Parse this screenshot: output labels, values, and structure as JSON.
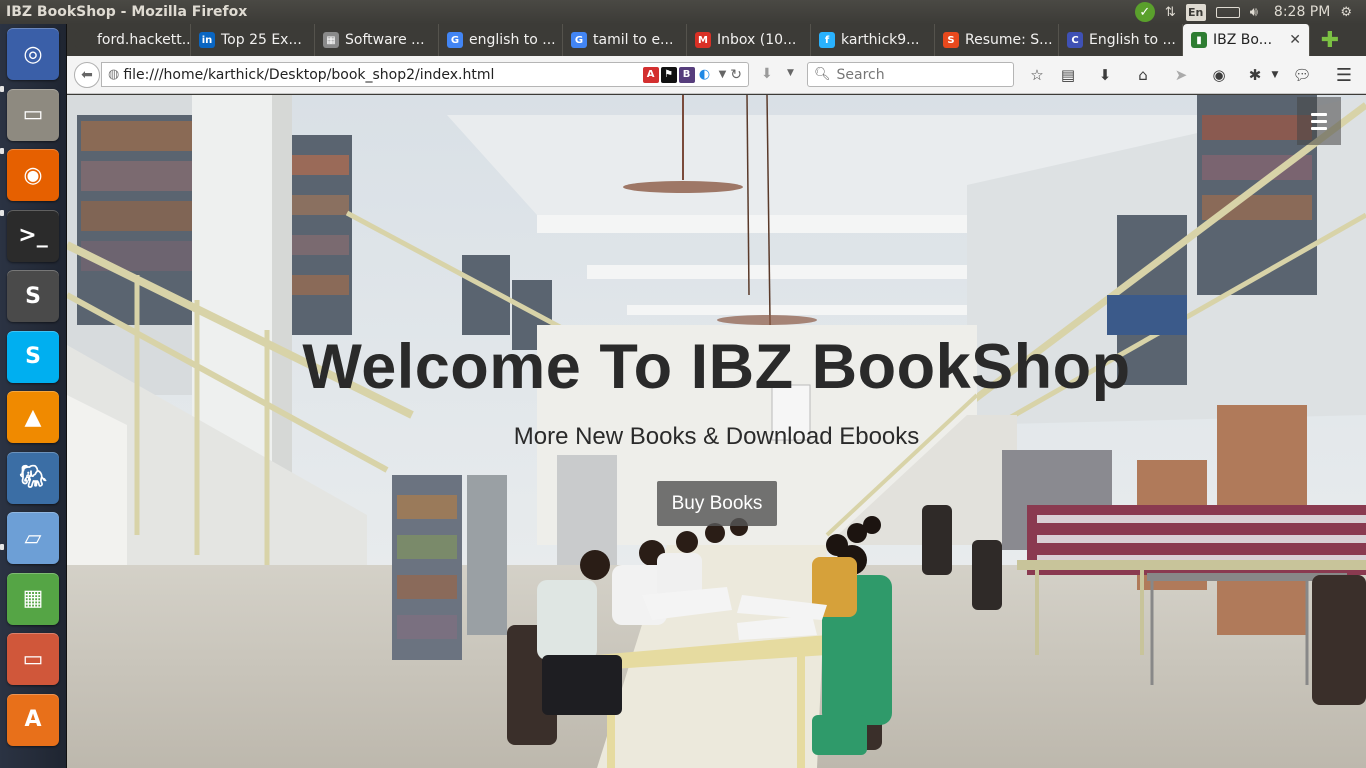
{
  "window": {
    "title": "IBZ BookShop - Mozilla Firefox"
  },
  "panel": {
    "lang": "En",
    "clock": "8:28 PM"
  },
  "launcher": {
    "items": [
      {
        "name": "ubuntu-dash",
        "icon": "ubuntu-logo-icon",
        "color": "#3a5fa8"
      },
      {
        "name": "files",
        "icon": "file-cabinet-icon",
        "color": "#8e8a80"
      },
      {
        "name": "firefox",
        "icon": "firefox-icon",
        "color": "#e66000"
      },
      {
        "name": "terminal",
        "icon": "terminal-icon",
        "color": "#2b2b2b"
      },
      {
        "name": "sublime-text",
        "icon": "sublime-icon",
        "color": "#4a4a4a"
      },
      {
        "name": "skype",
        "icon": "skype-icon",
        "color": "#00aff0"
      },
      {
        "name": "vlc",
        "icon": "vlc-cone-icon",
        "color": "#f08a00"
      },
      {
        "name": "postgresql",
        "icon": "elephant-icon",
        "color": "#3b6ea5"
      },
      {
        "name": "libreoffice-draw",
        "icon": "draw-icon",
        "color": "#6d9fd6"
      },
      {
        "name": "libreoffice-calc",
        "icon": "calc-icon",
        "color": "#55a545"
      },
      {
        "name": "libreoffice-impress",
        "icon": "impress-icon",
        "color": "#d0573a"
      },
      {
        "name": "software-center",
        "icon": "software-bag-icon",
        "color": "#e8701a"
      }
    ]
  },
  "tabs": [
    {
      "label": "ford.hackett...",
      "favicon": "blank",
      "fav_color": "#3c3b37",
      "fav_text": ""
    },
    {
      "label": "Top 25 Ex...",
      "favicon": "linkedin-icon",
      "fav_color": "#0a66c2",
      "fav_text": "in"
    },
    {
      "label": "Software ...",
      "favicon": "grid-icon",
      "fav_color": "#8a8a8a",
      "fav_text": "▦"
    },
    {
      "label": "english to ...",
      "favicon": "google-icon",
      "fav_color": "#4285f4",
      "fav_text": "G"
    },
    {
      "label": "tamil to e...",
      "favicon": "google-icon",
      "fav_color": "#4285f4",
      "fav_text": "G"
    },
    {
      "label": "Inbox (10...",
      "favicon": "gmail-icon",
      "fav_color": "#d93025",
      "fav_text": "M"
    },
    {
      "label": "karthick9...",
      "favicon": "freelancer-icon",
      "fav_color": "#29b2fe",
      "fav_text": "f"
    },
    {
      "label": "Resume: S...",
      "favicon": "s-icon",
      "fav_color": "#e8491d",
      "fav_text": "S"
    },
    {
      "label": "English to ...",
      "favicon": "c-icon",
      "fav_color": "#3f51b5",
      "fav_text": "C"
    },
    {
      "label": "IBZ Bo...",
      "favicon": "book-icon",
      "fav_color": "#2e7d32",
      "fav_text": "▮",
      "active": true
    }
  ],
  "navbar": {
    "url": "file:///home/karthick/Desktop/book_shop2/index.html",
    "search_placeholder": "Search"
  },
  "hero": {
    "title": "Welcome To IBZ BookShop",
    "subtitle": "More New Books & Download Ebooks",
    "button": "Buy Books"
  }
}
